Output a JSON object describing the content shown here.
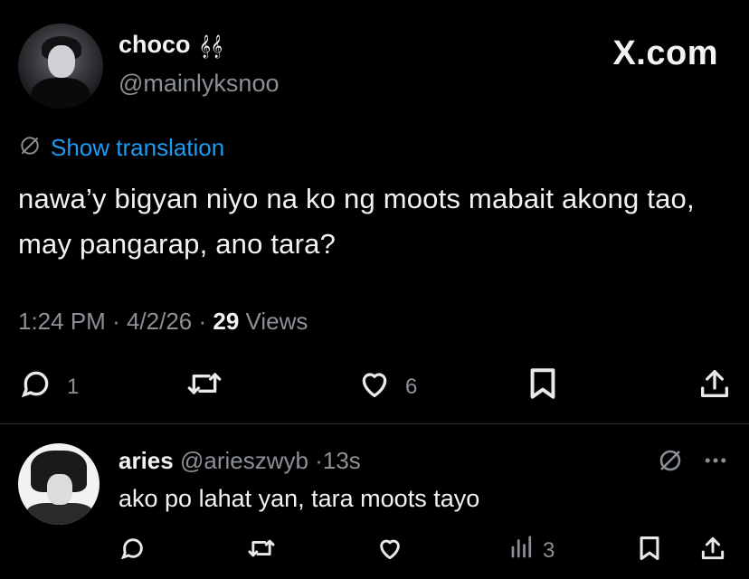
{
  "tweet": {
    "author_name": "choco",
    "author_name_deco": "𝄞𝄞",
    "handle": "@mainlyksnoo",
    "brand": "X.com",
    "show_translation": "Show translation",
    "text": "nawa’y bigyan niyo na ko ng moots mabait akong tao, may pangarap, ano tara?",
    "time": "1:24 PM",
    "date": "4/2/26",
    "views_count": "29",
    "views_label": "Views",
    "replies": "1",
    "likes": "6"
  },
  "reply": {
    "author_name": "aries",
    "handle": "@arieszwyb",
    "age": "13s",
    "text": "ako po lahat yan, tara moots tayo",
    "views": "3"
  },
  "icons": {
    "translate": "globe-slash-icon",
    "reply": "speech-bubble-icon",
    "repost": "repost-icon",
    "like": "heart-icon",
    "bookmark": "bookmark-icon",
    "share": "share-icon",
    "views": "bar-chart-icon",
    "more": "more-icon"
  },
  "colors": {
    "background": "#000000",
    "link": "#1d9bf0",
    "muted": "#8b9096",
    "text": "#f2f3f4"
  }
}
